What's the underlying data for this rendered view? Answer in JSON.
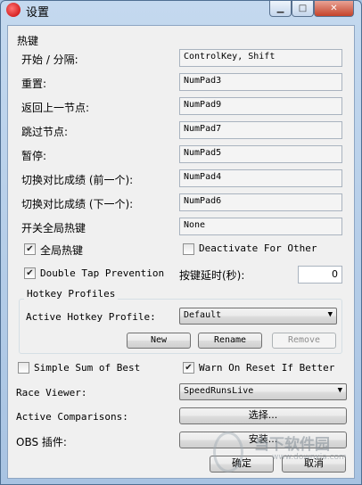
{
  "window": {
    "title": "设置",
    "min_glyph": "▁",
    "max_glyph": "□",
    "close_glyph": "✕"
  },
  "hotkeys": {
    "section_label": "热键",
    "rows": [
      {
        "label": "开始 / 分隔:",
        "value": "ControlKey, Shift"
      },
      {
        "label": "重置:",
        "value": "NumPad3"
      },
      {
        "label": "返回上一节点:",
        "value": "NumPad9"
      },
      {
        "label": "跳过节点:",
        "value": "NumPad7"
      },
      {
        "label": "暂停:",
        "value": "NumPad5"
      },
      {
        "label": "切换对比成绩 (前一个):",
        "value": "NumPad4"
      },
      {
        "label": "切换对比成绩 (下一个):",
        "value": "NumPad6"
      },
      {
        "label": "开关全局热键",
        "value": "None"
      }
    ],
    "global_hotkeys": {
      "label": "全局热键",
      "checked": true
    },
    "deactivate_for_other": {
      "label": "Deactivate For Other",
      "checked": false
    },
    "double_tap": {
      "label": "Double Tap Prevention",
      "checked": true
    },
    "delay": {
      "label": "按键延时(秒):",
      "value": "0"
    }
  },
  "profiles": {
    "legend": "Hotkey Profiles",
    "active_label": "Active Hotkey Profile:",
    "active_value": "Default",
    "new_label": "New",
    "rename_label": "Rename",
    "remove_label": "Remove"
  },
  "options": {
    "simple_sum": {
      "label": "Simple Sum of Best",
      "checked": false
    },
    "warn_reset": {
      "label": "Warn On Reset If Better",
      "checked": true
    },
    "race_viewer_label": "Race Viewer:",
    "race_viewer_value": "SpeedRunsLive",
    "active_comparisons_label": "Active Comparisons:",
    "select_label": "选择...",
    "obs_label": "OBS 插件:",
    "install_label": "安装..."
  },
  "footer": {
    "ok_label": "确定",
    "cancel_label": "取消"
  },
  "watermark": {
    "brand": "当下软件园",
    "url": "www.downxia.com"
  }
}
